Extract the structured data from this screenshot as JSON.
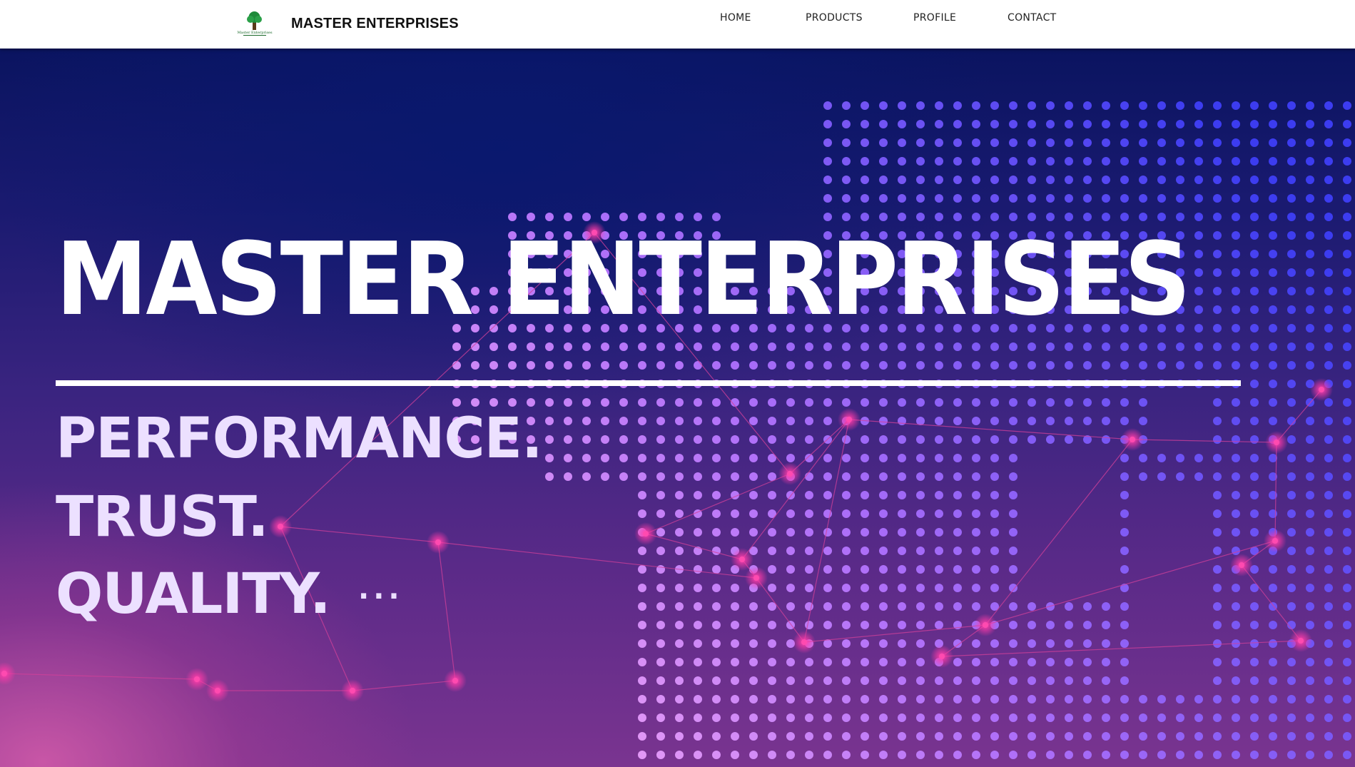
{
  "header": {
    "brand": "MASTER ENTERPRISES",
    "logo_icon": "tree-logo-icon",
    "logo_text": "Master Enterprises",
    "nav": [
      "HOME",
      "PRODUCTS",
      "PROFILE",
      "CONTACT"
    ]
  },
  "hero": {
    "title": "MASTER ENTERPRISES",
    "taglines": [
      "PERFORMANCE.",
      "TRUST.",
      "QUALITY."
    ],
    "ellipsis": "...",
    "background_icon": "world-map-dots-network-graphic"
  },
  "colors": {
    "hero_top": "#0a1460",
    "hero_bottom": "#7a3490",
    "dot_blue": "#4a4cf0",
    "dot_pink": "#f09ae8",
    "network_line": "#d0409a",
    "tagline": "#ece0ff"
  }
}
